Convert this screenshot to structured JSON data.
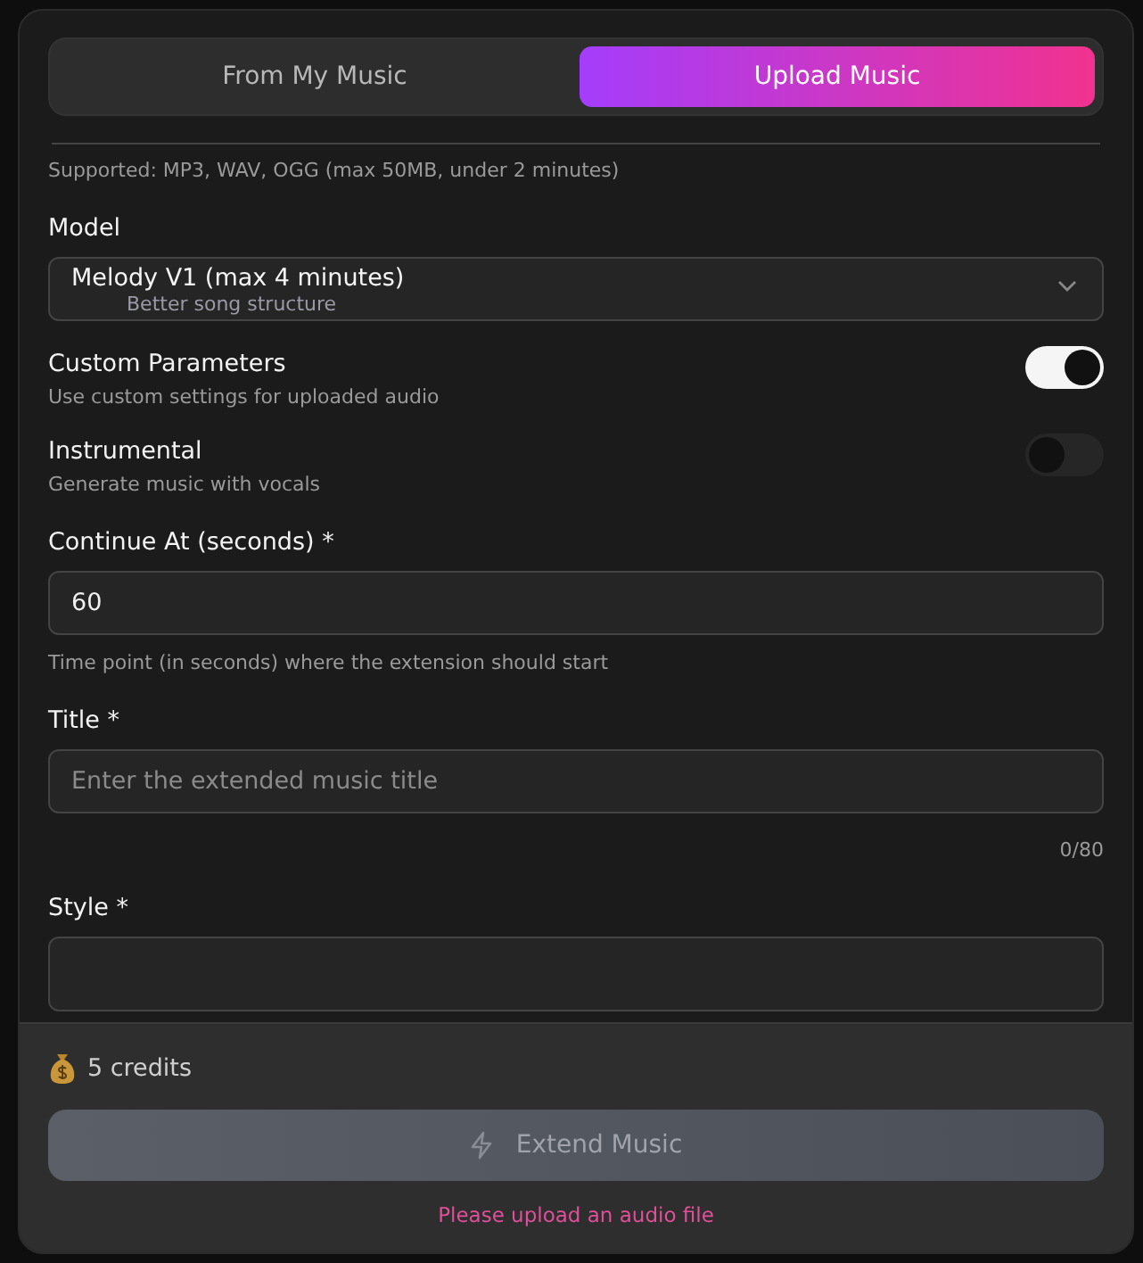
{
  "tabs": [
    {
      "label": "From My Music",
      "selected": false
    },
    {
      "label": "Upload Music",
      "selected": true
    }
  ],
  "supported_note": "Supported: MP3, WAV, OGG (max 50MB, under 2 minutes)",
  "model": {
    "label": "Model",
    "value": "Melody V1 (max 4 minutes)",
    "description": "Better song structure"
  },
  "switches": [
    {
      "label": "Custom Parameters",
      "description": "Use custom settings for uploaded audio",
      "on": true
    },
    {
      "label": "Instrumental",
      "description": "Generate music with vocals",
      "on": false
    }
  ],
  "continue_at": {
    "label": "Continue At (seconds) *",
    "value": "60",
    "hint": "Time point (in seconds) where the extension should start"
  },
  "title_field": {
    "label": "Title *",
    "placeholder": "Enter the extended music title",
    "counter": "0/80"
  },
  "style_field": {
    "label": "Style *"
  },
  "footer": {
    "credits": "5 credits",
    "button": {
      "label": "Extend Music",
      "disabled": true
    },
    "error": "Please upload an audio file"
  }
}
